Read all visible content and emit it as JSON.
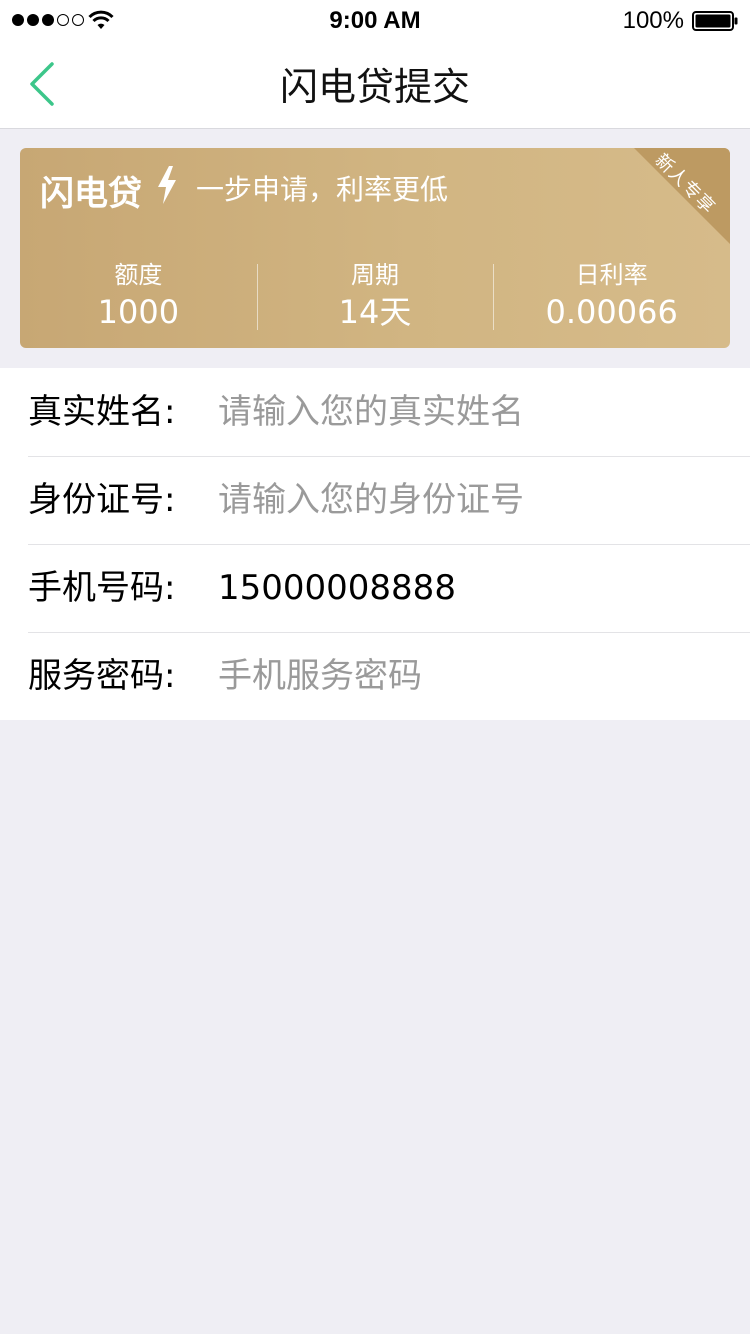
{
  "status_bar": {
    "time": "9:00 AM",
    "battery": "100%",
    "signal_filled": 3,
    "signal_total": 5
  },
  "nav": {
    "title": "闪电贷提交",
    "back_icon": "chevron-left-icon",
    "back_color": "#3cc68a"
  },
  "card": {
    "brand": "闪电贷",
    "slogan": "一步申请，利率更低",
    "badge": "新人专享",
    "bolt_icon": "lightning-icon",
    "stats": [
      {
        "label": "额度",
        "value": "1000"
      },
      {
        "label": "周期",
        "value": "14天"
      },
      {
        "label": "日利率",
        "value": "0.00066"
      }
    ]
  },
  "form": {
    "rows": [
      {
        "label": "真实姓名:",
        "value": "",
        "placeholder": "请输入您的真实姓名"
      },
      {
        "label": "身份证号:",
        "value": "",
        "placeholder": "请输入您的身份证号"
      },
      {
        "label": "手机号码:",
        "value": "15000008888",
        "placeholder": ""
      },
      {
        "label": "服务密码:",
        "value": "",
        "placeholder": "手机服务密码"
      }
    ]
  },
  "colors": {
    "accent": "#3cc68a",
    "card_gold": "#d1b582",
    "placeholder": "#9a9a9a",
    "background": "#efeef4"
  }
}
